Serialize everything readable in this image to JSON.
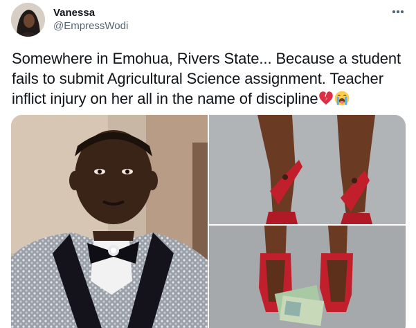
{
  "tweet": {
    "author": {
      "display_name": "Vanessa",
      "handle": "@EmpressWodi"
    },
    "text": "Somewhere in Emohua, Rivers State... Because a student fails to submit Agricultural Science assignment. Teacher inflict injury on her all in the name of discipline",
    "emojis": [
      "broken-heart",
      "loudly-crying-face"
    ],
    "media": [
      {
        "subject": "man in sequined suit with bow tie and brooch"
      },
      {
        "subject": "legs in red slippers with injuries"
      },
      {
        "subject": "feet in red slippers near naira notes"
      }
    ],
    "more_icon": "more-horizontal-icon"
  }
}
